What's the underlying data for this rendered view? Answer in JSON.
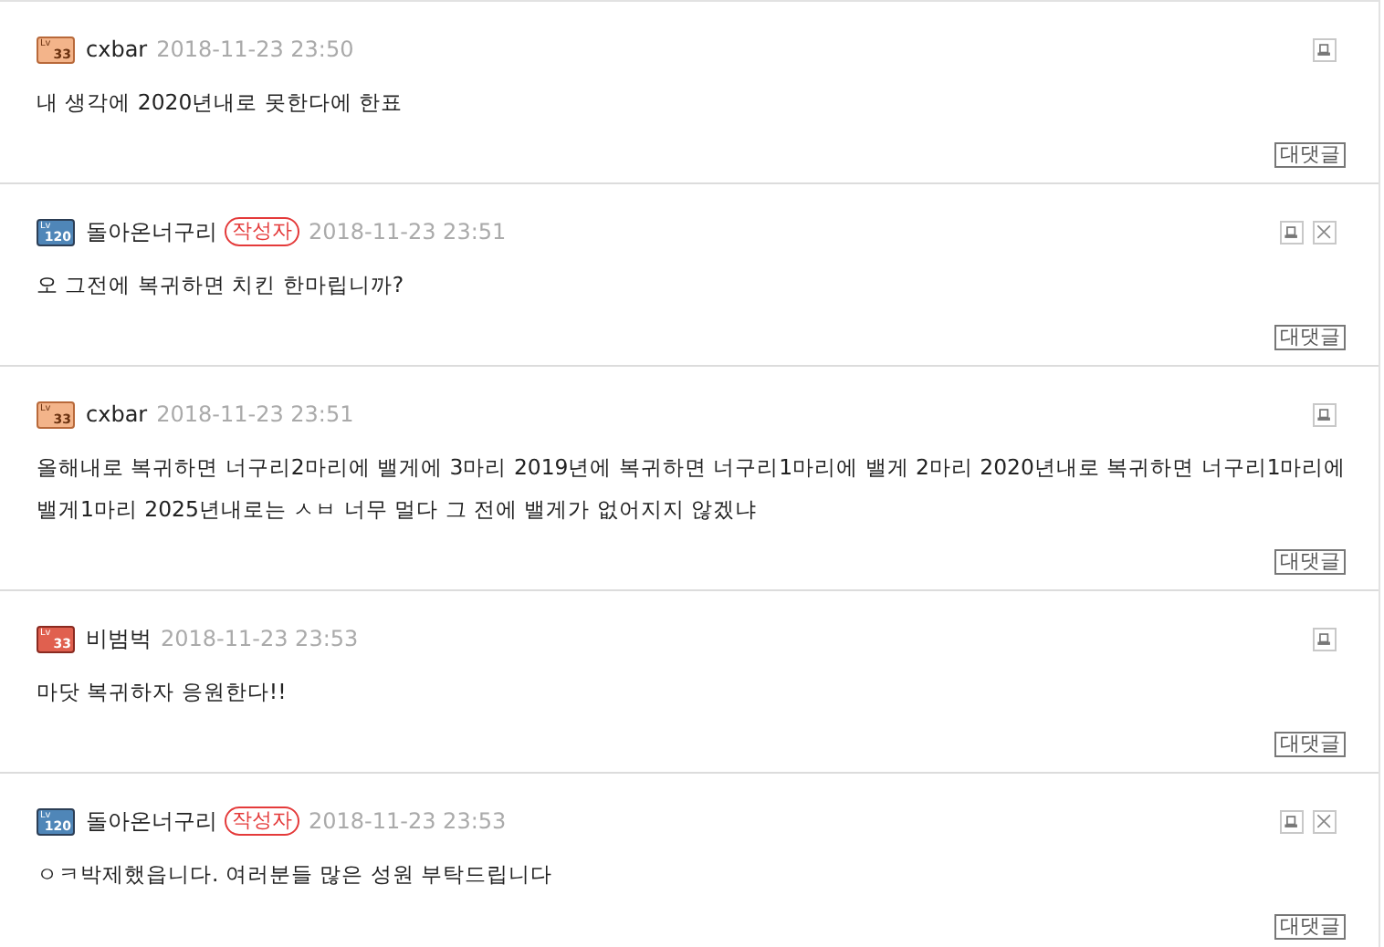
{
  "comments": [
    {
      "badge": {
        "kind": "orange",
        "lv": "Lv",
        "num": "33"
      },
      "author": "cxbar",
      "date": "2018-11-23 23:50",
      "text": "내 생각에 2020년내로 못한다에 한표",
      "can_delete": false,
      "reply_label": "대댓글"
    },
    {
      "badge": {
        "kind": "blue",
        "lv": "Lv",
        "num": "120"
      },
      "author": "돌아온너구리",
      "author_tag": "작성자",
      "date": "2018-11-23 23:51",
      "text": "오 그전에 복귀하면 치킨 한마립니까?",
      "can_delete": true,
      "reply_label": "대댓글"
    },
    {
      "badge": {
        "kind": "orange",
        "lv": "Lv",
        "num": "33"
      },
      "author": "cxbar",
      "date": "2018-11-23 23:51",
      "text": "올해내로 복귀하면 너구리2마리에 밸게에 3마리 2019년에 복귀하면 너구리1마리에 밸게 2마리 2020년내로 복귀하면 너구리1마리에 밸게1마리 2025년내로는 ㅅㅂ 너무 멀다 그 전에 밸게가 없어지지 않겠냐",
      "can_delete": false,
      "reply_label": "대댓글"
    },
    {
      "badge": {
        "kind": "red",
        "lv": "Lv",
        "num": "33"
      },
      "author": "비범벅",
      "date": "2018-11-23 23:53",
      "text": "마닷 복귀하자 응원한다!!",
      "can_delete": false,
      "reply_label": "대댓글"
    },
    {
      "badge": {
        "kind": "blue",
        "lv": "Lv",
        "num": "120"
      },
      "author": "돌아온너구리",
      "author_tag": "작성자",
      "date": "2018-11-23 23:53",
      "text": "ㅇㅋ박제했읍니다. 여러분들 많은 성원 부탁드립니다",
      "can_delete": true,
      "reply_label": "대댓글"
    }
  ]
}
